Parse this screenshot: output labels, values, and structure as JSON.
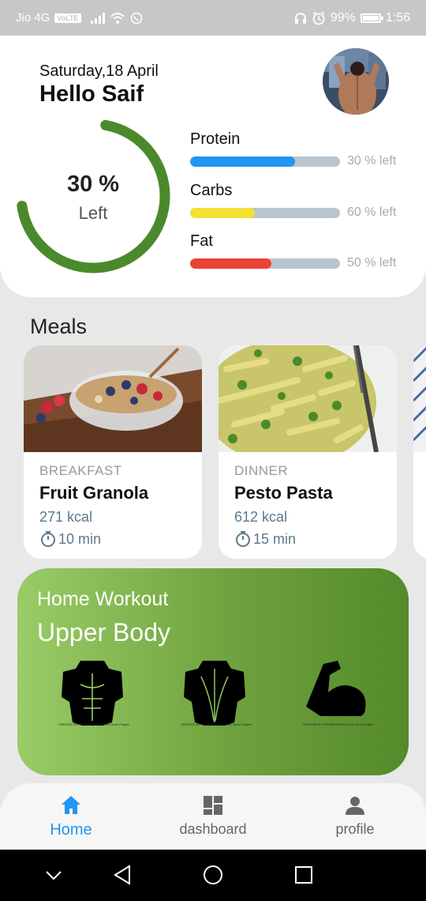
{
  "status_bar": {
    "carrier": "Jio 4G",
    "volte": "VoLTE",
    "battery": "99%",
    "time": "1:56",
    "icons": [
      "signal-icon",
      "wifi-icon",
      "whatsapp-icon",
      "headphones-icon",
      "alarm-icon",
      "battery-icon"
    ]
  },
  "header": {
    "date": "Saturday,18 April",
    "greeting": "Hello Saif"
  },
  "calories": {
    "percent_text": "30 %",
    "left_label": "Left",
    "progress": 0.7,
    "color": "#4a8a2c"
  },
  "macros": [
    {
      "name": "Protein",
      "left": "30 % left",
      "fill": 0.7,
      "color": "#2196f3"
    },
    {
      "name": "Carbs",
      "left": "60 % left",
      "fill": 0.43,
      "color": "#f5e132"
    },
    {
      "name": "Fat",
      "left": "50 % left",
      "fill": 0.54,
      "color": "#ea4335"
    }
  ],
  "meals": {
    "title": "Meals",
    "items": [
      {
        "type": "BREAKFAST",
        "name": "Fruit Granola",
        "kcal": "271 kcal",
        "time": "10 min"
      },
      {
        "type": "DINNER",
        "name": "Pesto Pasta",
        "kcal": "612 kcal",
        "time": "15 min"
      }
    ]
  },
  "workout": {
    "subtitle": "Home Workout",
    "title": "Upper Body",
    "icons": [
      "chest-muscle-icon",
      "back-muscle-icon",
      "bicep-icon"
    ],
    "captions": [
      "CREATED BY PROMOTHEUS\nFrom Noun Project",
      "CREATED BY PROMOTHEUS\nFrom Noun Project",
      "CREATED BY PROMOTHEUS\nFrom Noun Project"
    ]
  },
  "bottom_nav": {
    "items": [
      {
        "label": "Home",
        "icon": "home-icon",
        "active": true
      },
      {
        "label": "dashboard",
        "icon": "dashboard-icon",
        "active": false
      },
      {
        "label": "profile",
        "icon": "person-icon",
        "active": false
      }
    ]
  },
  "system_nav": {
    "icons": [
      "chevron-down-icon",
      "back-icon",
      "home-circle-icon",
      "recents-icon"
    ]
  }
}
